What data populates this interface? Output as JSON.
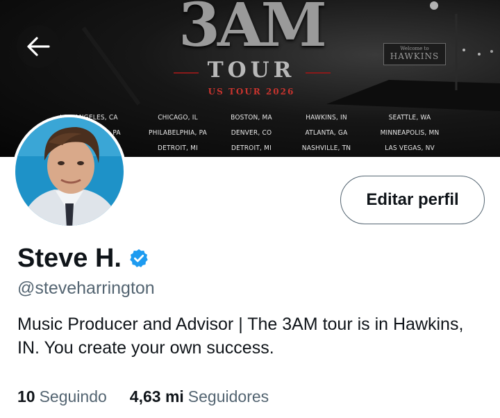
{
  "banner": {
    "title": "3AM",
    "subtitle": "TOUR",
    "tagline": "US TOUR 2026",
    "sign_small": "Welcome to",
    "sign_big": "HAWKINS",
    "cities": [
      [
        "LOS ANGELES, CA",
        "PA",
        ""
      ],
      [
        "CHICAGO, IL",
        "PHILABELPHIA, PA",
        "DETROIT, MI"
      ],
      [
        "BOSTON, MA",
        "DENVER, CO",
        "DETROIT, MI"
      ],
      [
        "HAWKINS, IN",
        "ATLANTA, GA",
        "NASHVILLE, TN"
      ],
      [
        "SEATTLE, WA",
        "MINNEAPOLIS, MN",
        "LAS VEGAS, NV"
      ]
    ]
  },
  "profile": {
    "name": "Steve H.",
    "handle": "@steveharrington",
    "bio": "Music Producer and Advisor | The 3AM tour is in Hawkins, IN. You create your own success.",
    "edit_label": "Editar perfil",
    "verified_icon": "verified-badge-icon",
    "accent": "#1d9bf0"
  },
  "stats": {
    "following_count": "10",
    "following_label": "Seguindo",
    "followers_count": "4,63 mi",
    "followers_label": "Seguidores"
  }
}
